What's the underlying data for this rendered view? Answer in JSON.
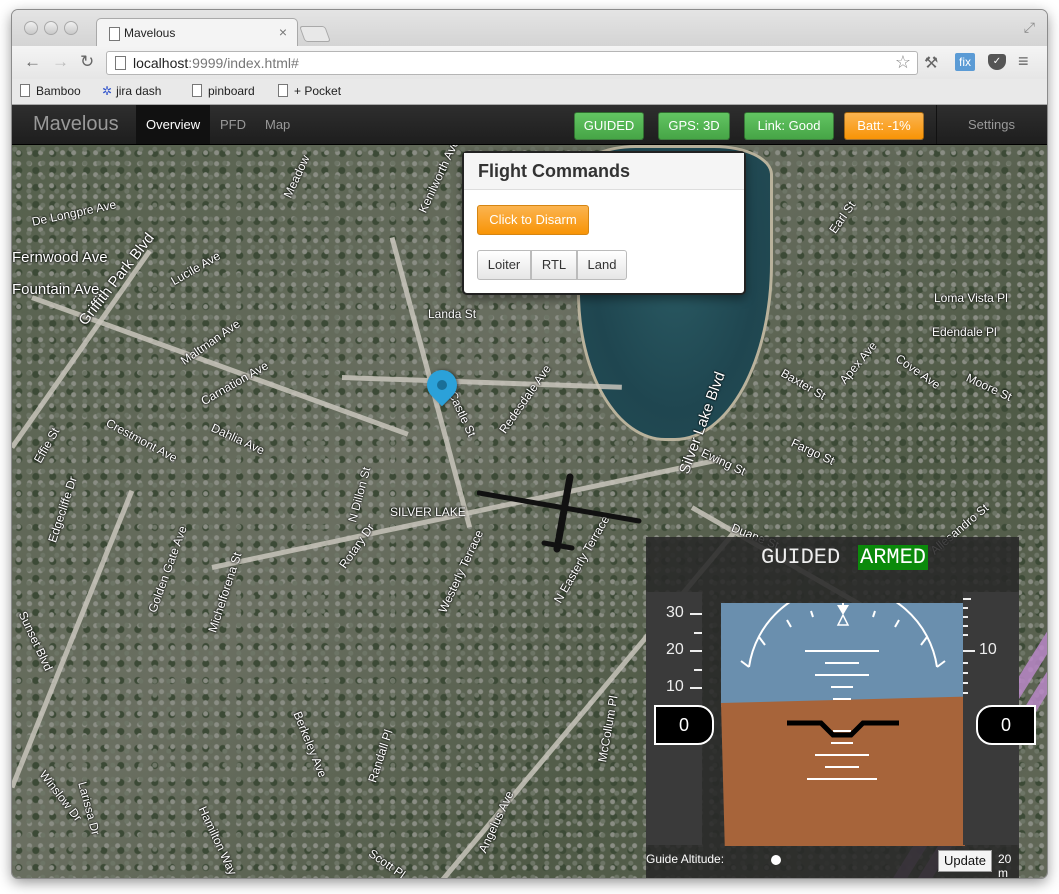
{
  "browser": {
    "tab_title": "Mavelous",
    "tab_close": "×",
    "url_host": "localhost",
    "url_rest": ":9999/index.html#",
    "bookmarks": [
      "Bamboo",
      "jira dash",
      "pinboard",
      "+ Pocket"
    ],
    "icons": {
      "back": "←",
      "forward": "→",
      "reload": "↻",
      "star": "☆",
      "wrench": "🔧",
      "fix": "fix",
      "menu": "≡",
      "fullscreen": "⤢"
    }
  },
  "app": {
    "brand": "Mavelous",
    "nav": [
      "Overview",
      "PFD",
      "Map"
    ],
    "status": {
      "mode": "GUIDED",
      "gps": "GPS: 3D",
      "link": "Link: Good",
      "batt": "Batt: -1%"
    },
    "settings": "Settings"
  },
  "flight_commands": {
    "title": "Flight Commands",
    "disarm": "Click to Disarm",
    "buttons": [
      "Loiter",
      "RTL",
      "Land"
    ]
  },
  "map": {
    "streets": [
      "Griffith Park Blvd",
      "Lucile Ave",
      "Maltman Ave",
      "Carnation Ave",
      "Dahlia Ave",
      "Crestmont Ave",
      "Effie St",
      "Edgecliffe Dr",
      "Golden Gate Ave",
      "Michelforena St",
      "Landa St",
      "Castle St",
      "Redesdale Ave",
      "Silver Lake Blvd",
      "Baxter St",
      "Fargo St",
      "Ewing St",
      "Apex Ave",
      "SILVER LAKE",
      "N Dillon St",
      "Westerly Terrace",
      "N Easterly Terrace",
      "Berkeley Ave",
      "Randall Pl",
      "Allesandro St",
      "Duane St",
      "Edendale Pl",
      "Loma Vista Pl",
      "Moore St",
      "Cove Ave",
      "Earl St",
      "Kenilworth Ave",
      "Meadow",
      "Sunset Blvd",
      "Winslow Dr",
      "Larissa Dr",
      "Hamilton Way",
      "Scott Pl",
      "McCollum Pl",
      "Angelus Ave",
      "Rotary Dr",
      "De Longpre Ave",
      "Fernwood Ave",
      "Fountain Ave",
      "Landa St.",
      "Silver Lake Blvd.",
      "Lucile Ave."
    ]
  },
  "pfd": {
    "mode": "GUIDED",
    "armed": "ARMED",
    "speed_ticks": [
      "30",
      "20",
      "10"
    ],
    "speed_readout": "0",
    "alt_ticks": [
      "10"
    ],
    "alt_readout": "0",
    "guide_label": "Guide Altitude:",
    "update": "Update",
    "guide_value": "20 m"
  },
  "colors": {
    "guided_badge": "#46a546",
    "batt_badge": "#f89406",
    "armed": "#0b8a0b",
    "sky": "#6a8fae",
    "ground": "#a7643a"
  }
}
